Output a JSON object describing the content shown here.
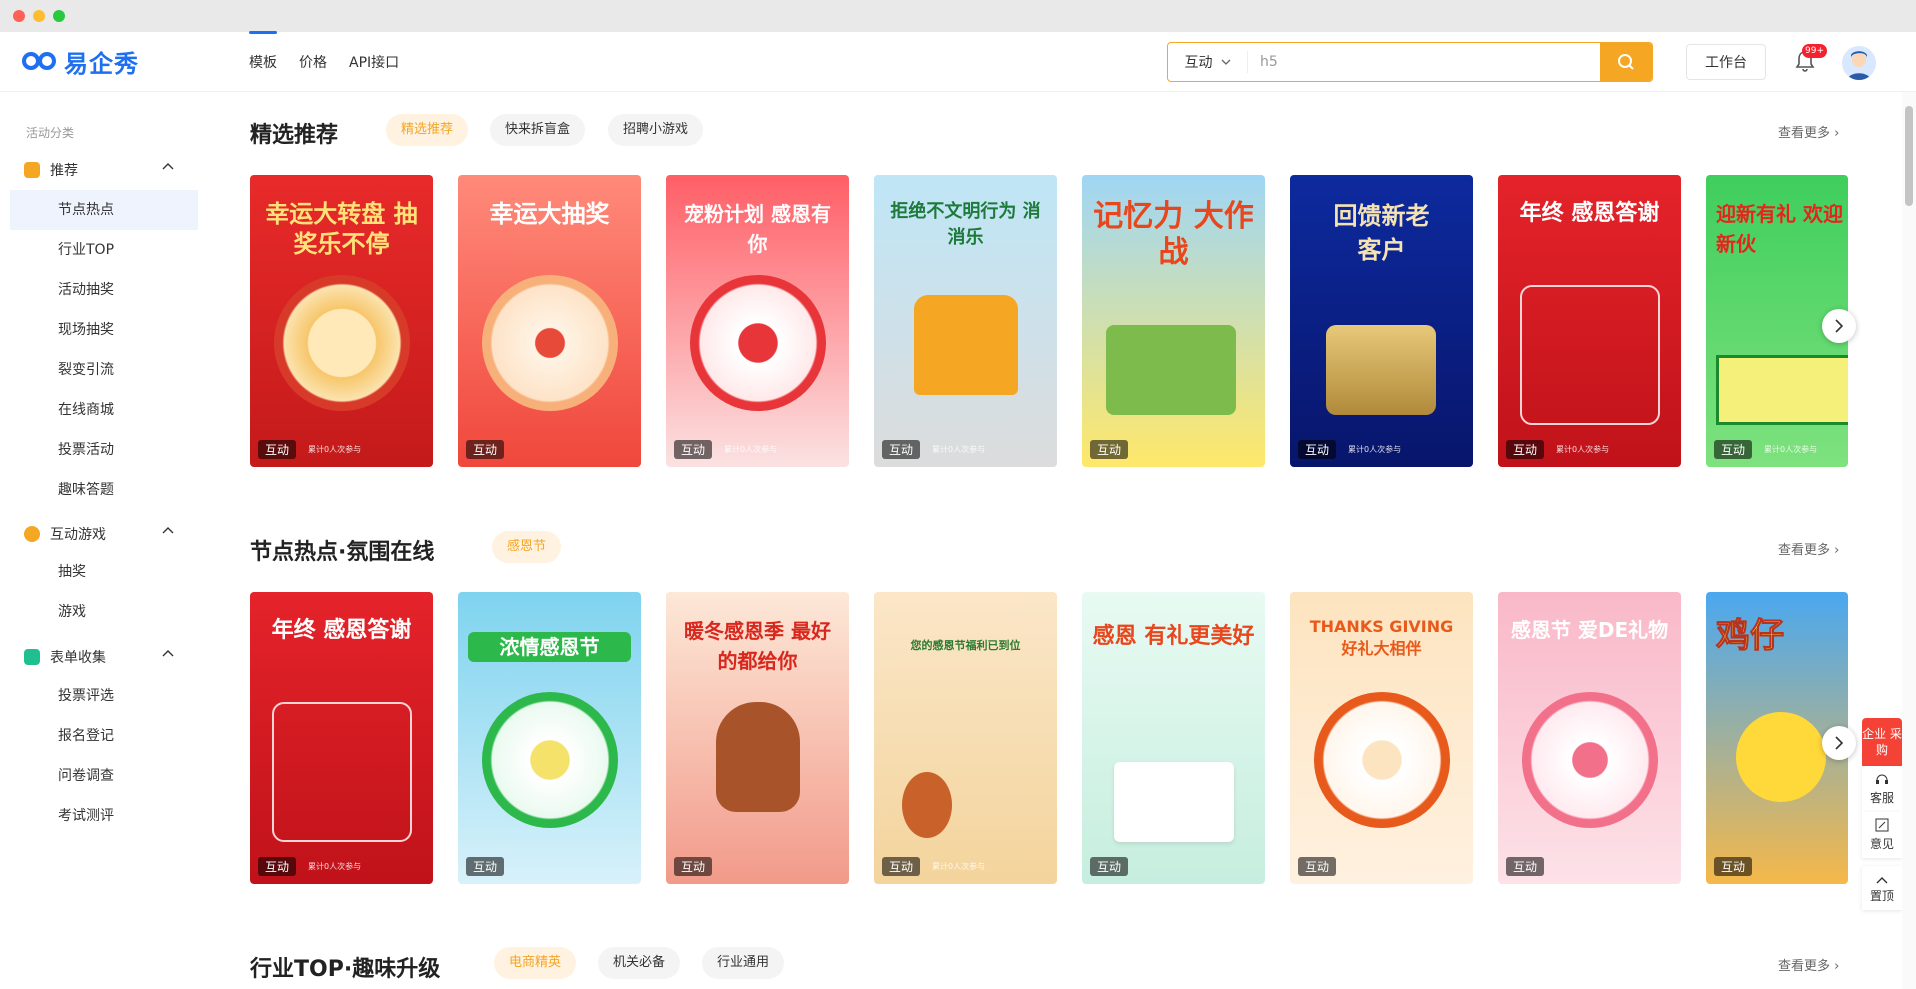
{
  "header": {
    "logo_text": "易企秀",
    "nav": [
      "模板",
      "价格",
      "API接口"
    ],
    "search_type": "互动",
    "search_value": "h5",
    "workbench": "工作台",
    "badge": "99+",
    "accent": "#f5a623",
    "brand": "#1e6ff1"
  },
  "sidebar": {
    "category_label": "活动分类",
    "groups": [
      {
        "label": "推荐",
        "items": [
          "节点热点",
          "行业TOP",
          "活动抽奖",
          "现场抽奖",
          "裂变引流",
          "在线商城",
          "投票活动",
          "趣味答题"
        ]
      },
      {
        "label": "互动游戏",
        "items": [
          "抽奖",
          "游戏"
        ]
      },
      {
        "label": "表单收集",
        "items": [
          "投票评选",
          "报名登记",
          "问卷调查",
          "考试测评"
        ]
      }
    ]
  },
  "sections": [
    {
      "title": "精选推荐",
      "chips": [
        "精选推荐",
        "快来拆盲盒",
        "招聘小游戏"
      ],
      "more": "查看更多 ›",
      "cards": [
        {
          "title": "幸运大转盘 抽奖乐不停",
          "tag": "互动",
          "count": "累计0人次参与"
        },
        {
          "title": "幸运大抽奖",
          "tag": "互动",
          "count": ""
        },
        {
          "title": "宠粉计划 感恩有你",
          "tag": "互动",
          "count": "累计0人次参与"
        },
        {
          "title": "拒绝不文明行为 消消乐",
          "tag": "互动",
          "count": "累计0人次参与"
        },
        {
          "title": "记忆力 大作战",
          "tag": "互动",
          "count": ""
        },
        {
          "title": "回馈新老客户",
          "tag": "互动",
          "count": "累计0人次参与"
        },
        {
          "title": "年终 感恩答谢",
          "tag": "互动",
          "count": "累计0人次参与"
        },
        {
          "title": "迎新有礼 欢迎新伙",
          "tag": "互动",
          "count": "累计0人次参与"
        }
      ]
    },
    {
      "title": "节点热点·氛围在线",
      "chips": [
        "感恩节"
      ],
      "more": "查看更多 ›",
      "cards": [
        {
          "title": "年终 感恩答谢",
          "tag": "互动",
          "count": "累计0人次参与"
        },
        {
          "title": "浓情感恩节",
          "tag": "互动",
          "count": ""
        },
        {
          "title": "暖冬感恩季 最好的都给你",
          "tag": "互动",
          "count": ""
        },
        {
          "title": "您的感恩节福利已到位",
          "tag": "互动",
          "count": "累计0人次参与"
        },
        {
          "title": "感恩 有礼更美好",
          "tag": "互动",
          "count": ""
        },
        {
          "title": "THANKS GIVING 好礼大相伴",
          "tag": "互动",
          "count": ""
        },
        {
          "title": "感恩节 爱DE礼物",
          "tag": "互动",
          "count": ""
        },
        {
          "title": "鸡仔",
          "tag": "互动",
          "count": ""
        }
      ]
    },
    {
      "title": "行业TOP·趣味升级",
      "chips": [
        "电商精英",
        "机关必备",
        "行业通用"
      ],
      "more": "查看更多 ›"
    }
  ],
  "float_bar": {
    "enterprise": "企业 采购",
    "service": "客服",
    "feedback": "意见",
    "top": "置顶"
  }
}
